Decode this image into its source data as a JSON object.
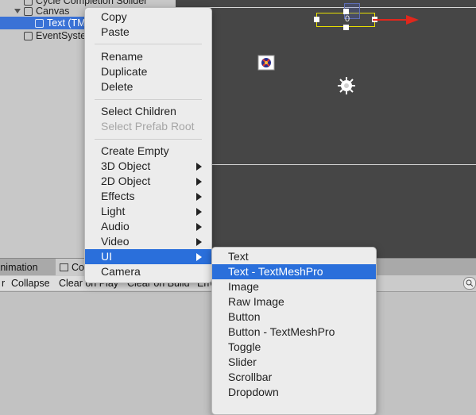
{
  "hierarchy": {
    "rows": [
      {
        "label": "Cycle Completion Sollder",
        "depth": 2,
        "selected": false
      },
      {
        "label": "Canvas",
        "depth": 1,
        "selected": false
      },
      {
        "label": "Text (TMP)",
        "depth": 2,
        "selected": true
      },
      {
        "label": "EventSystem",
        "depth": 1,
        "selected": false
      }
    ]
  },
  "scene": {
    "gizmo_value": "0"
  },
  "bottom_panel": {
    "tabs": [
      "Animation",
      "Console"
    ],
    "toolbar": [
      "r",
      "Collapse",
      "Clear on Play",
      "Clear on Build",
      "Error Pause"
    ],
    "search_icon": "search-icon"
  },
  "context_menu": {
    "items": [
      {
        "label": "Copy",
        "disabled": false,
        "submenu": false
      },
      {
        "label": "Paste",
        "disabled": false,
        "submenu": false
      },
      {
        "separator": true
      },
      {
        "label": "Rename",
        "disabled": false,
        "submenu": false
      },
      {
        "label": "Duplicate",
        "disabled": false,
        "submenu": false
      },
      {
        "label": "Delete",
        "disabled": false,
        "submenu": false
      },
      {
        "separator": true
      },
      {
        "label": "Select Children",
        "disabled": false,
        "submenu": false
      },
      {
        "label": "Select Prefab Root",
        "disabled": true,
        "submenu": false
      },
      {
        "separator": true
      },
      {
        "label": "Create Empty",
        "disabled": false,
        "submenu": false
      },
      {
        "label": "3D Object",
        "disabled": false,
        "submenu": true
      },
      {
        "label": "2D Object",
        "disabled": false,
        "submenu": true
      },
      {
        "label": "Effects",
        "disabled": false,
        "submenu": true
      },
      {
        "label": "Light",
        "disabled": false,
        "submenu": true
      },
      {
        "label": "Audio",
        "disabled": false,
        "submenu": true
      },
      {
        "label": "Video",
        "disabled": false,
        "submenu": true
      },
      {
        "label": "UI",
        "disabled": false,
        "submenu": true,
        "highlighted": true
      },
      {
        "label": "Camera",
        "disabled": false,
        "submenu": false
      }
    ]
  },
  "ui_submenu": {
    "items": [
      {
        "label": "Text"
      },
      {
        "label": "Text - TextMeshPro",
        "highlighted": true
      },
      {
        "label": "Image"
      },
      {
        "label": "Raw Image"
      },
      {
        "label": "Button"
      },
      {
        "label": "Button - TextMeshPro"
      },
      {
        "label": "Toggle"
      },
      {
        "label": "Slider"
      },
      {
        "label": "Scrollbar"
      },
      {
        "label": "Dropdown"
      }
    ]
  },
  "colors": {
    "highlight": "#2a6fdb",
    "selection": "#3a72d6",
    "scene_bg": "#464646",
    "gizmo_yellow": "#e8e000",
    "gizmo_red": "#e0271c"
  }
}
